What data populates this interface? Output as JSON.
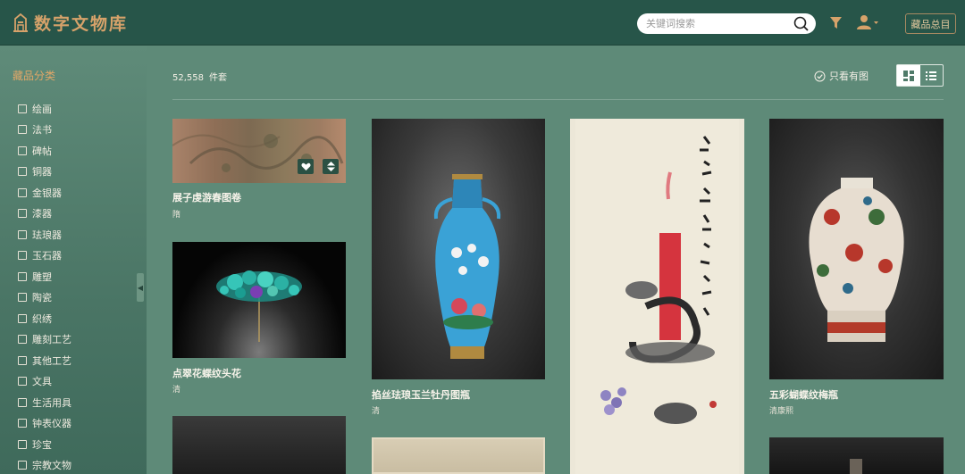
{
  "header": {
    "title": "数字文物库",
    "search_placeholder": "关键词搜索",
    "catalog_label": "藏品总目"
  },
  "sidebar": {
    "title": "藏品分类",
    "items": [
      "绘画",
      "法书",
      "碑帖",
      "铜器",
      "金银器",
      "漆器",
      "珐琅器",
      "玉石器",
      "雕塑",
      "陶瓷",
      "织绣",
      "雕刻工艺",
      "其他工艺",
      "文具",
      "生活用具",
      "钟表仪器",
      "珍宝",
      "宗教文物"
    ]
  },
  "toolbar": {
    "count": "52,558",
    "count_unit": "件套",
    "only_with_image": "只看有图"
  },
  "items": [
    {
      "title": "展子虔游春图卷",
      "dynasty": "隋"
    },
    {
      "title": "点翠花蝶纹头花",
      "dynasty": "清"
    },
    {
      "title": "掐丝珐琅玉兰牡丹图瓶",
      "dynasty": "清"
    },
    {
      "title": "五彩蝴蝶纹梅瓶",
      "dynasty": "清康熙"
    }
  ],
  "colors": {
    "header_bg": "#275549",
    "page_bg": "#5e8a78",
    "accent": "#d6a26a"
  }
}
